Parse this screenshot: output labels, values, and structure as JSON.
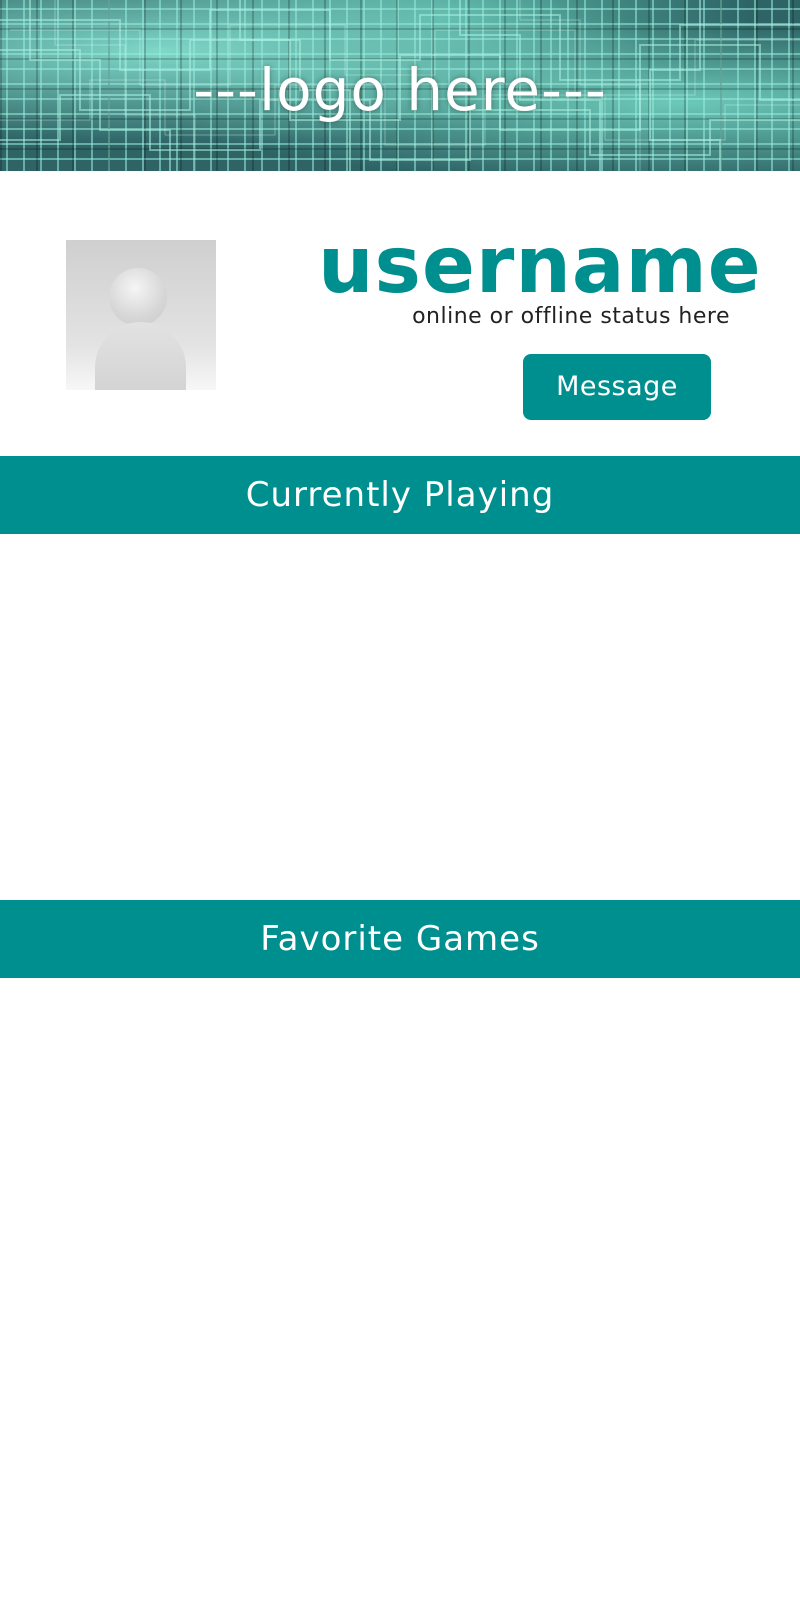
{
  "header": {
    "logo_text": "---logo here---"
  },
  "profile": {
    "avatar_icon": "default-user-avatar-icon",
    "username": "username",
    "status": "online or offline status here",
    "message_button_label": "Message"
  },
  "sections": {
    "currently_playing": {
      "title": "Currently Playing"
    },
    "favorite_games": {
      "title": "Favorite Games"
    }
  },
  "colors": {
    "accent": "#008f8f",
    "background": "#ffffff",
    "text_dark": "#222222"
  }
}
